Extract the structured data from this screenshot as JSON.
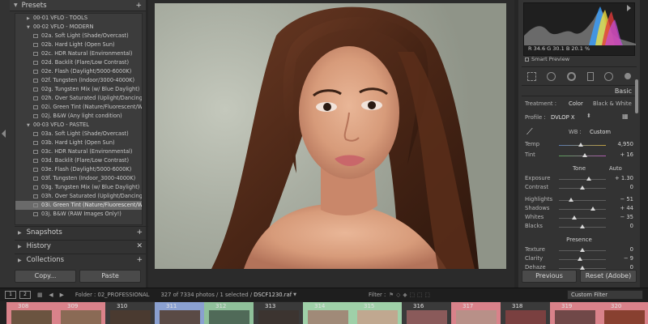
{
  "left_panel": {
    "presets_title": "Presets",
    "tree": [
      {
        "kind": "folder",
        "label": "00-01 VFLO - TOOLS",
        "open": false
      },
      {
        "kind": "folder",
        "label": "00-02 VFLO - MODERN",
        "open": true
      },
      {
        "kind": "item",
        "label": "02a. Soft Light (Shade/Overcast)"
      },
      {
        "kind": "item",
        "label": "02b. Hard Light (Open Sun)"
      },
      {
        "kind": "item",
        "label": "02c. HDR Natural (Environmental)"
      },
      {
        "kind": "item",
        "label": "02d. Backlit (Flare/Low Contrast)"
      },
      {
        "kind": "item",
        "label": "02e. Flash (Daylight/5000-6000K)"
      },
      {
        "kind": "item",
        "label": "02f. Tungsten (Indoor/3000-4000K)"
      },
      {
        "kind": "item",
        "label": "02g. Tungsten Mix (w/ Blue Daylight)"
      },
      {
        "kind": "item",
        "label": "02h. Over Saturated (Uplight/Dancing)"
      },
      {
        "kind": "item",
        "label": "02i. Green Tint (Nature/Fluorescent/Window)"
      },
      {
        "kind": "item",
        "label": "02j. B&W (Any light condition)"
      },
      {
        "kind": "folder",
        "label": "00-03 VFLO - PASTEL",
        "open": true
      },
      {
        "kind": "item",
        "label": "03a. Soft Light (Shade/Overcast)"
      },
      {
        "kind": "item",
        "label": "03b. Hard Light (Open Sun)"
      },
      {
        "kind": "item",
        "label": "03c. HDR Natural (Environmental)"
      },
      {
        "kind": "item",
        "label": "03d. Backlit (Flare/Low Contrast)"
      },
      {
        "kind": "item",
        "label": "03e. Flash (Daylight/5000-6000K)"
      },
      {
        "kind": "item",
        "label": "03f. Tungsten (Indoor_3000-4000K)"
      },
      {
        "kind": "item",
        "label": "03g. Tungsten Mix (w/ Blue Daylight)"
      },
      {
        "kind": "item",
        "label": "03h. Over Saturated (Uplight/Dancing)"
      },
      {
        "kind": "item",
        "label": "03i. Green Tint (Nature/Fluorescent/Window)",
        "selected": true
      },
      {
        "kind": "item",
        "label": "03j. B&W (RAW Images Only!)"
      }
    ],
    "snapshots_title": "Snapshots",
    "history_title": "History",
    "collections_title": "Collections",
    "copy_label": "Copy...",
    "paste_label": "Paste"
  },
  "right_panel": {
    "histogram": {
      "r_label": "R",
      "r": "34.6",
      "g_label": "G",
      "g": "30.1",
      "b_label": "B",
      "b": "20.1",
      "unit": "%"
    },
    "smart_preview": "Smart Preview",
    "basic_title": "Basic",
    "treatment_label": "Treatment :",
    "treatment_color": "Color",
    "treatment_bw": "Black & White",
    "profile_label": "Profile :",
    "profile_value": "DVLOP X",
    "wb_label": "WB :",
    "wb_value": "Custom",
    "temp_label": "Temp",
    "temp_value": "4,950",
    "tint_label": "Tint",
    "tint_value": "+ 16",
    "tone_title": "Tone",
    "auto_label": "Auto",
    "exposure_label": "Exposure",
    "exposure_value": "+ 1.30",
    "contrast_label": "Contrast",
    "contrast_value": "0",
    "highlights_label": "Highlights",
    "highlights_value": "− 51",
    "shadows_label": "Shadows",
    "shadows_value": "+ 44",
    "whites_label": "Whites",
    "whites_value": "− 35",
    "blacks_label": "Blacks",
    "blacks_value": "0",
    "presence_title": "Presence",
    "texture_label": "Texture",
    "texture_value": "0",
    "clarity_label": "Clarity",
    "clarity_value": "− 9",
    "dehaze_label": "Dehaze",
    "dehaze_value": "0",
    "previous_label": "Previous",
    "reset_label": "Reset (Adobe)",
    "slider_levels": {
      "temp": 0.47,
      "tint": 0.56,
      "exposure": 0.63,
      "contrast": 0.5,
      "highlights": 0.25,
      "shadows": 0.72,
      "whites": 0.33,
      "blacks": 0.5,
      "texture": 0.5,
      "clarity": 0.45,
      "dehaze": 0.5
    }
  },
  "filmstrip_bar": {
    "view1": "1",
    "view2": "2",
    "folder_text": "Folder : 02_PROFESSIONAL",
    "count_text": "327 of 7334 photos / 1 selected /",
    "filename": "DSCF1230.raf",
    "filter_label": "Filter :",
    "custom_filter": "Custom Filter"
  },
  "filmstrip": {
    "cells": [
      {
        "num": "308",
        "color": "#d9828a",
        "thumb": "#6b5440"
      },
      {
        "num": "309",
        "color": "#d9828a",
        "thumb": "#8a6a55"
      },
      {
        "num": "310",
        "color": "#3a3a3a",
        "thumb": "#4a3a30"
      },
      {
        "num": "311",
        "color": "#8aa0d0",
        "thumb": "#5a4a45"
      },
      {
        "num": "312",
        "color": "#8fc09a",
        "thumb": "#506a58"
      },
      {
        "num": "313",
        "color": "#3a3a3a",
        "thumb": "#3c3430"
      },
      {
        "num": "314",
        "color": "#9fd0a8",
        "thumb": "#a08a78"
      },
      {
        "num": "315",
        "color": "#9fd0a8",
        "thumb": "#c0a890"
      },
      {
        "num": "316",
        "color": "#3a3a3a",
        "thumb": "#8a5a5a"
      },
      {
        "num": "317",
        "color": "#d9828a",
        "thumb": "#b89088"
      },
      {
        "num": "318",
        "color": "#3a3a3a",
        "thumb": "#7a4040"
      },
      {
        "num": "319",
        "color": "#d9828a",
        "thumb": "#704848"
      },
      {
        "num": "320",
        "color": "#d9828a",
        "thumb": "#884030"
      }
    ]
  }
}
